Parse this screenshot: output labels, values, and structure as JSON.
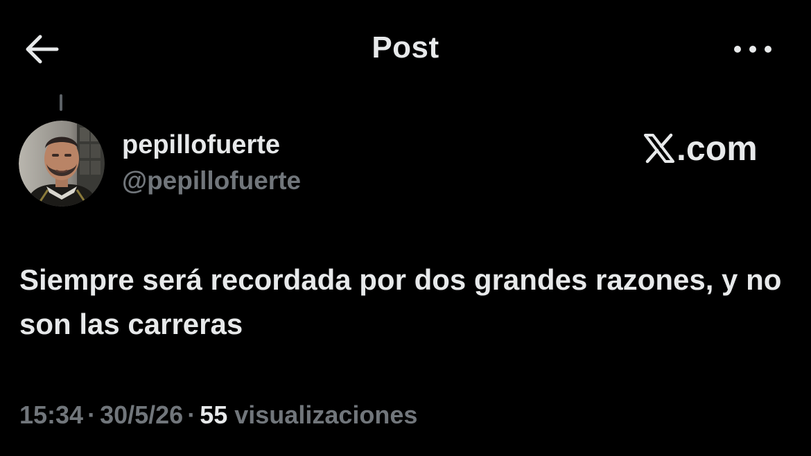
{
  "header": {
    "title": "Post",
    "back_icon": "arrow-left-icon",
    "more_icon": "more-horizontal-icon"
  },
  "author": {
    "display_name": "pepillofuerte",
    "handle": "@pepillofuerte",
    "avatar_icon": "profile-photo"
  },
  "watermark": {
    "text": ".com",
    "logo_icon": "x-logo-icon"
  },
  "post": {
    "text": "Siempre será recordada por dos grandes razones, y no son las carreras"
  },
  "meta": {
    "time": "15:34",
    "separator": "·",
    "date": "30/5/26",
    "views_count": "55",
    "views_label": "visualizaciones"
  },
  "colors": {
    "background": "#000000",
    "primary_text": "#e7e9ea",
    "secondary_text": "#71767b"
  }
}
